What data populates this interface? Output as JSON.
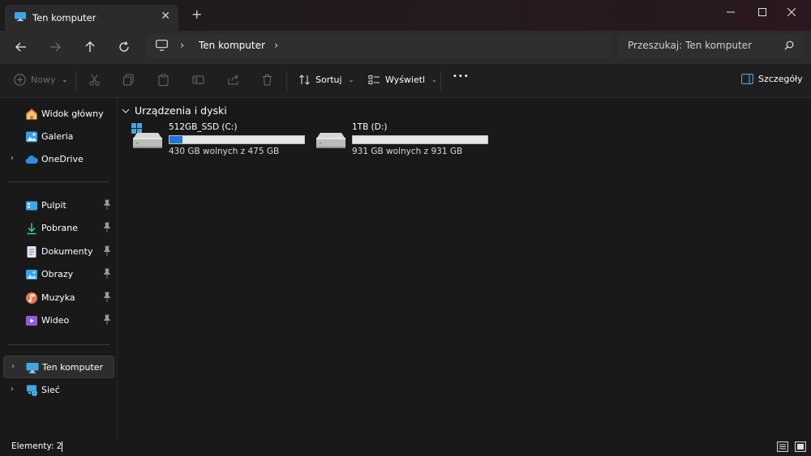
{
  "window": {
    "tab_title": "Ten komputer",
    "new_tab_symbol": "+",
    "close_tab_symbol": "✕"
  },
  "address": {
    "crumb": "Ten komputer"
  },
  "search": {
    "placeholder": "Przeszukaj: Ten komputer"
  },
  "commands": {
    "new_label": "Nowy",
    "sort_label": "Sortuj",
    "view_label": "Wyświetl",
    "more_label": "•••",
    "details_label": "Szczegóły"
  },
  "sidebar": {
    "items": [
      {
        "label": "Widok główny"
      },
      {
        "label": "Galeria"
      },
      {
        "label": "OneDrive"
      },
      {
        "label": "Pulpit"
      },
      {
        "label": "Pobrane"
      },
      {
        "label": "Dokumenty"
      },
      {
        "label": "Obrazy"
      },
      {
        "label": "Muzyka"
      },
      {
        "label": "Wideo"
      },
      {
        "label": "Ten komputer"
      },
      {
        "label": "Sieć"
      }
    ]
  },
  "main": {
    "group_title": "Urządzenia i dyski",
    "drives": [
      {
        "name": "512GB_SSD (C:)",
        "free_text": "430 GB wolnych z 475 GB",
        "used_fraction": 0.095
      },
      {
        "name": "1TB (D:)",
        "free_text": "931 GB wolnych z 931 GB",
        "used_fraction": 0.0
      }
    ]
  },
  "status": {
    "items_count": "Elementy: 2"
  },
  "colors": {
    "accent": "#1b78d4",
    "background": "#191919",
    "toolbar": "#2b2b2b"
  }
}
